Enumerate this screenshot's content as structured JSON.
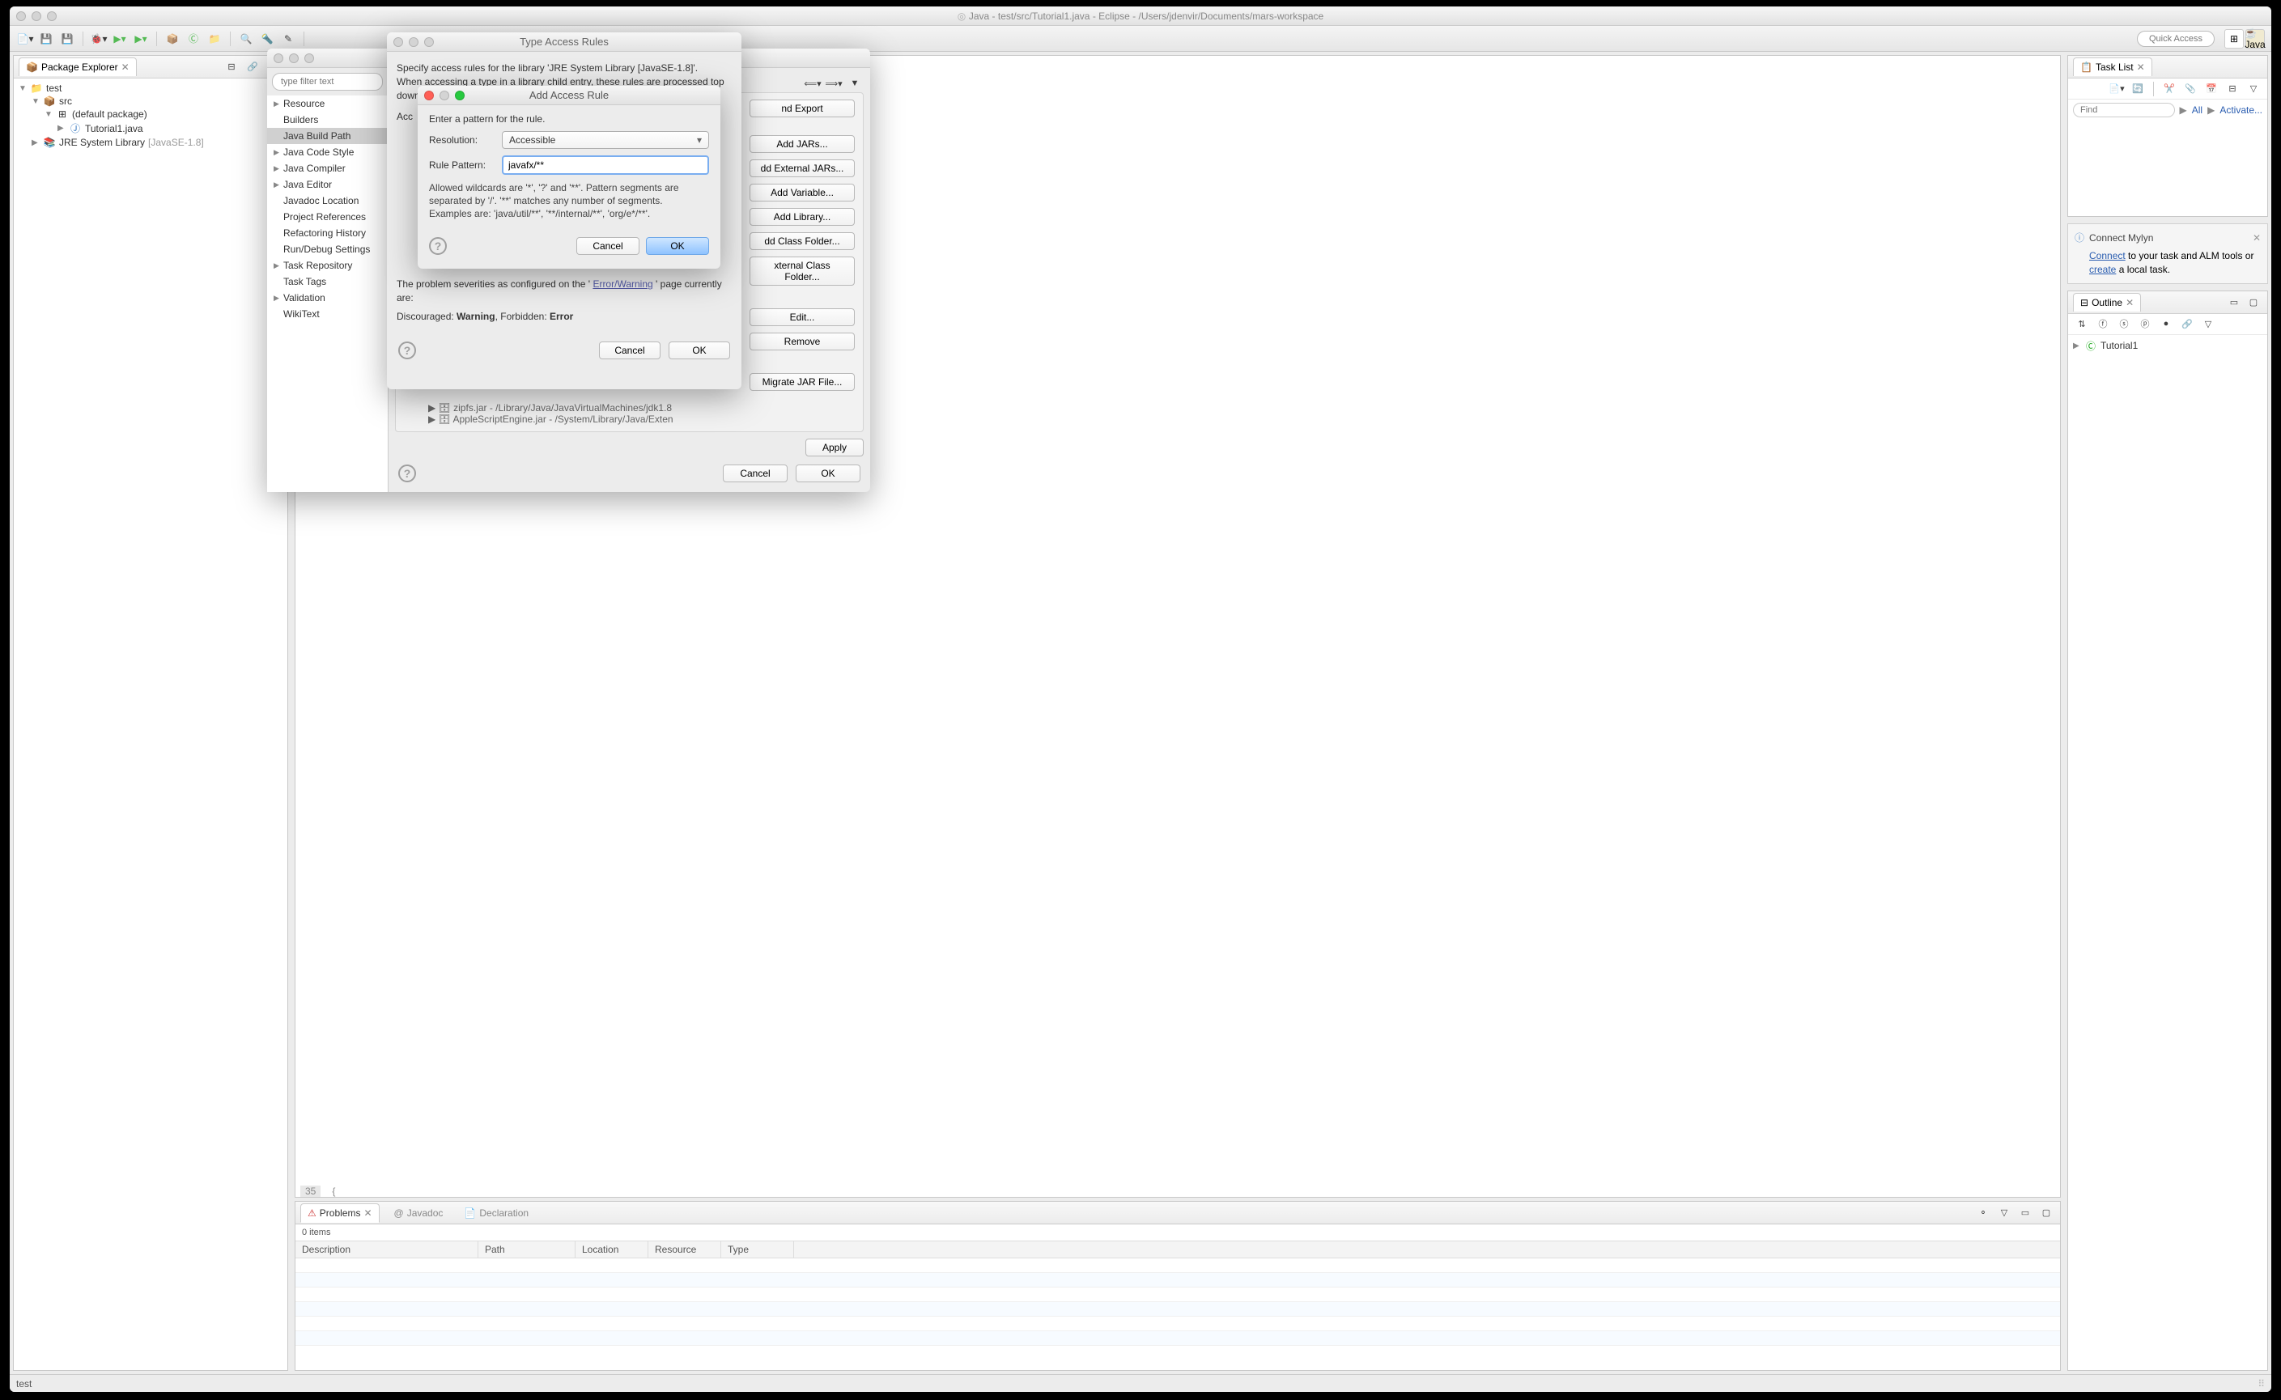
{
  "window": {
    "title": "Java - test/src/Tutorial1.java - Eclipse - /Users/jdenvir/Documents/mars-workspace",
    "quick_access": "Quick Access"
  },
  "package_explorer": {
    "title": "Package Explorer",
    "tree": {
      "project": "test",
      "src": "src",
      "pkg": "(default package)",
      "file": "Tutorial1.java",
      "jre": "JRE System Library",
      "jre_profile": "[JavaSE-1.8]"
    }
  },
  "task_list": {
    "title": "Task List",
    "find_placeholder": "Find",
    "all": "All",
    "activate": "Activate..."
  },
  "mylyn": {
    "title": "Connect Mylyn",
    "connect": "Connect",
    "text1": " to your task and ALM tools or ",
    "create": "create",
    "text2": " a local task."
  },
  "outline": {
    "title": "Outline",
    "item": "Tutorial1"
  },
  "problems": {
    "tab_problems": "Problems",
    "tab_javadoc": "Javadoc",
    "tab_declaration": "Declaration",
    "items": "0 items",
    "col_description": "Description",
    "col_path": "Path",
    "col_location": "Location",
    "col_resource": "Resource",
    "col_type": "Type"
  },
  "status": {
    "text": "test"
  },
  "editor": {
    "line_num": "35",
    "line_text": "{"
  },
  "props_dialog": {
    "filter_placeholder": "type filter text",
    "items": {
      "resource": "Resource",
      "builders": "Builders",
      "java_build_path": "Java Build Path",
      "java_code_style": "Java Code Style",
      "java_compiler": "Java Compiler",
      "java_editor": "Java Editor",
      "javadoc_location": "Javadoc Location",
      "project_references": "Project References",
      "refactoring_history": "Refactoring History",
      "run_debug": "Run/Debug Settings",
      "task_repository": "Task Repository",
      "task_tags": "Task Tags",
      "validation": "Validation",
      "wikitext": "WikiText"
    },
    "side_buttons": {
      "and_export": "nd Export",
      "add_jars": "Add JARs...",
      "add_external": "dd External JARs...",
      "add_variable": "Add Variable...",
      "add_library": "Add Library...",
      "add_class_folder": "dd Class Folder...",
      "external_class_folder": "xternal Class Folder...",
      "edit": "Edit...",
      "remove": "Remove",
      "migrate": "Migrate JAR File..."
    },
    "apply": "Apply",
    "cancel": "Cancel",
    "ok": "OK",
    "jar1": "zipfs.jar - /Library/Java/JavaVirtualMachines/jdk1.8",
    "jar2": "AppleScriptEngine.jar - /System/Library/Java/Exten"
  },
  "tar_dialog": {
    "title": "Type Access Rules",
    "text1": "Specify access rules for the library 'JRE System Library [JavaSE-1.8]'.",
    "text2": "When accessing a type in a library child entry, these rules are processed top down until a rule pattern matches. When no pattern matches, the rules def",
    "acc_label": "Acc",
    "severity_text1": "The problem severities as configured on the '",
    "severity_link": "Error/Warning",
    "severity_text2": "' page currently are:",
    "discouraged": "Discouraged: ",
    "warning": "Warning",
    "forbidden": ", Forbidden: ",
    "error": "Error",
    "cancel": "Cancel",
    "ok": "OK"
  },
  "aar_dialog": {
    "title": "Add Access Rule",
    "instruction": "Enter a pattern for the rule.",
    "resolution_label": "Resolution:",
    "resolution_value": "Accessible",
    "pattern_label": "Rule Pattern:",
    "pattern_value": "javafx/**",
    "help1": "Allowed wildcards are '*', '?' and '**'. Pattern segments are separated by '/'. '**' matches any number of segments.",
    "help2": "Examples are: 'java/util/**', '**/internal/**', 'org/e*/**'.",
    "cancel": "Cancel",
    "ok": "OK"
  }
}
